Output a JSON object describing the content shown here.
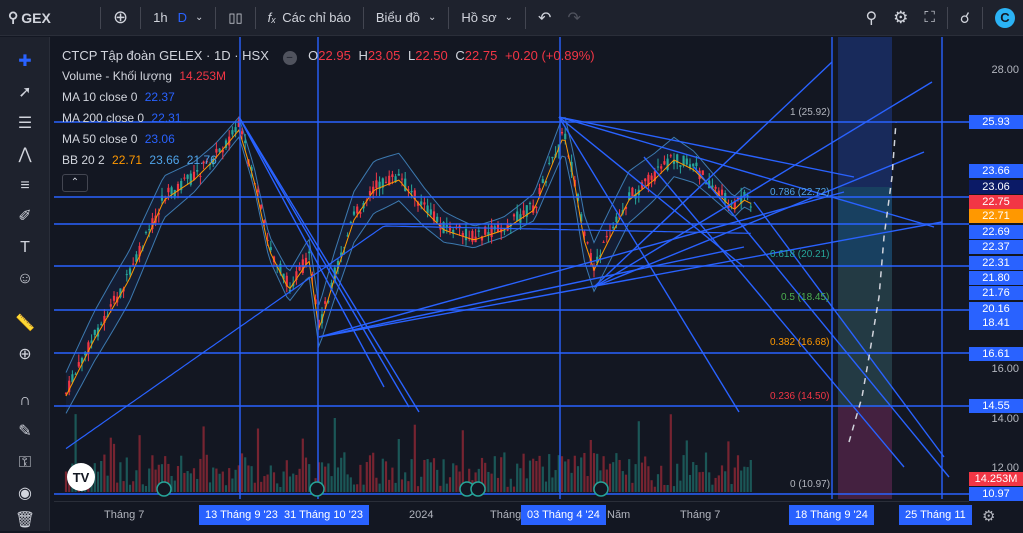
{
  "topbar": {
    "symbol": "GEX",
    "interval": "1h",
    "interval_flag": "D",
    "indicators_label": "Các chỉ báo",
    "chart_label": "Biểu đồ",
    "profile_label": "Hồ sơ"
  },
  "legend": {
    "title": "CTCP Tập đoàn GELEX · 1D · HSX",
    "o_label": "O",
    "o_value": "22.95",
    "h_label": "H",
    "h_value": "23.05",
    "l_label": "L",
    "l_value": "22.50",
    "c_label": "C",
    "c_value": "22.75",
    "change": "+0.20 (+0.89%)",
    "volume_label": "Volume - Khối lượng",
    "volume_value": "14.253M",
    "ma10_label": "MA 10 close 0",
    "ma10_value": "22.37",
    "ma200_label": "MA 200 close 0",
    "ma200_value": "22.31",
    "ma50_label": "MA 50 close 0",
    "ma50_value": "23.06",
    "bb_label": "BB 20 2",
    "bb_v1": "22.71",
    "bb_v2": "23.66",
    "bb_v3": "21.76"
  },
  "fib_levels": [
    {
      "label": "1 (25.92)",
      "color": "#b2b5be"
    },
    {
      "label": "0.786 (22.72)",
      "color": "#4fa3e8"
    },
    {
      "label": "0.618 (20.21)",
      "color": "#26a69a"
    },
    {
      "label": "0.5 (18.45)",
      "color": "#4caf50"
    },
    {
      "label": "0.382 (16.68)",
      "color": "#ff9800"
    },
    {
      "label": "0.236 (14.50)",
      "color": "#f23645"
    },
    {
      "label": "0 (10.97)",
      "color": "#b2b5be"
    }
  ],
  "price_ticks": [
    "28.00",
    "16.00",
    "14.00",
    "12.00"
  ],
  "price_labels": [
    {
      "text": "25.93",
      "bg": "#2962ff"
    },
    {
      "text": "23.66",
      "bg": "#2962ff"
    },
    {
      "text": "23.06",
      "bg": "#0b1a66"
    },
    {
      "text": "22.75",
      "bg": "#f23645"
    },
    {
      "text": "22.71",
      "bg": "#ff9800"
    },
    {
      "text": "22.69",
      "bg": "#2962ff"
    },
    {
      "text": "22.37",
      "bg": "#2962ff"
    },
    {
      "text": "22.31",
      "bg": "#2962ff"
    },
    {
      "text": "21.80",
      "bg": "#2962ff"
    },
    {
      "text": "21.76",
      "bg": "#2962ff"
    },
    {
      "text": "20.16",
      "bg": "#2962ff"
    },
    {
      "text": "18.41",
      "bg": "#2962ff"
    },
    {
      "text": "16.61",
      "bg": "#2962ff"
    },
    {
      "text": "14.55",
      "bg": "#2962ff"
    },
    {
      "text": "14.253M",
      "bg": "#f23645"
    },
    {
      "text": "10.97",
      "bg": "#2962ff"
    }
  ],
  "x_labels": [
    "Tháng 7",
    "2024",
    "Tháng",
    "Năm",
    "Tháng 7",
    "T"
  ],
  "x_highlights": [
    "13 Tháng 9 '23",
    "31 Tháng 10 '23",
    "03 Tháng 4 '24",
    "18 Tháng 9 '24",
    "25 Tháng 11"
  ],
  "colors": {
    "up": "#26a69a",
    "down": "#f23645",
    "accent": "#2962ff",
    "bg": "#131722"
  },
  "icons": [
    "search-icon",
    "add-icon",
    "candles-icon",
    "fx-icon",
    "undo-icon",
    "redo-icon",
    "zoom-icon",
    "gear-icon",
    "fullscreen-icon",
    "share-icon",
    "app-logo-icon"
  ]
}
